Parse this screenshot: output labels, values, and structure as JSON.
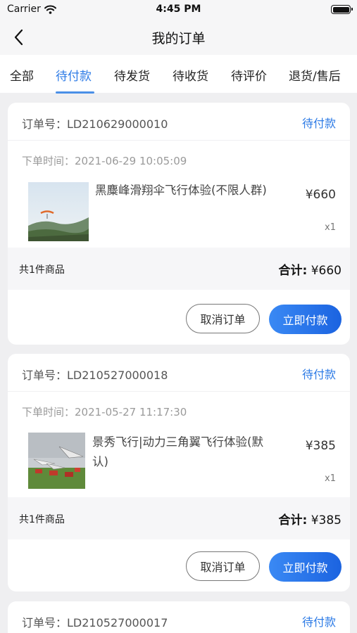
{
  "status_bar": {
    "carrier": "Carrier",
    "time": "4:45 PM"
  },
  "nav": {
    "title": "我的订单"
  },
  "tabs": [
    {
      "label": "全部"
    },
    {
      "label": "待付款",
      "active": true
    },
    {
      "label": "待发货"
    },
    {
      "label": "待收货"
    },
    {
      "label": "待评价"
    },
    {
      "label": "退货/售后"
    }
  ],
  "orders": [
    {
      "order_no": "订单号：LD210629000010",
      "status": "待付款",
      "order_time": "下单时间：2021-06-29 10:05:09",
      "product_name": "黑麋峰滑翔伞飞行体验(不限人群)",
      "price": "¥660",
      "qty": "x1",
      "count_text": "共1件商品",
      "total_label": "合计:",
      "total_value": "¥660",
      "cancel_label": "取消订单",
      "pay_label": "立即付款"
    },
    {
      "order_no": "订单号：LD210527000018",
      "status": "待付款",
      "order_time": "下单时间：2021-05-27 11:17:30",
      "product_name": "景秀飞行|动力三角翼飞行体验(默认)",
      "price": "¥385",
      "qty": "x1",
      "count_text": "共1件商品",
      "total_label": "合计:",
      "total_value": "¥385",
      "cancel_label": "取消订单",
      "pay_label": "立即付款"
    },
    {
      "order_no": "订单号：LD210527000017",
      "status": "待付款"
    }
  ],
  "colors": {
    "accent": "#2d7be6",
    "pay_button": "#1b63e0"
  },
  "icons": {
    "back": "chevron-left-icon",
    "wifi": "wifi-icon",
    "battery": "battery-icon"
  }
}
